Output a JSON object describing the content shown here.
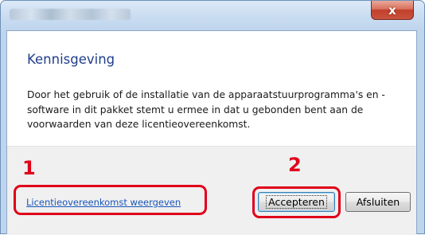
{
  "window": {
    "close_label": "x"
  },
  "notice": {
    "heading": "Kennisgeving",
    "body": "Door het gebruik of de installatie van de apparaatstuurprogramma's en -software in dit pakket stemt u ermee in dat u gebonden bent aan de voorwaarden van deze licentieovereenkomst."
  },
  "footer": {
    "link_label": "Licentieovereenkomst weergeven",
    "accept_label": "Accepteren",
    "exit_label": "Afsluiten"
  },
  "callouts": {
    "one": "1",
    "two": "2"
  },
  "colors": {
    "heading": "#1f3d8a",
    "link": "#1a56b8",
    "callout": "#e0001a"
  }
}
